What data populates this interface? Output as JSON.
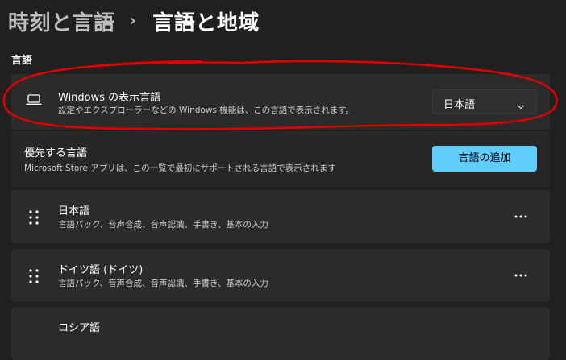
{
  "breadcrumb": {
    "parent": "時刻と言語",
    "separator": "›",
    "current": "言語と地域"
  },
  "section": {
    "title": "言語"
  },
  "display_language": {
    "title": "Windows の表示言語",
    "subtitle": "設定やエクスプローラーなどの Windows 機能は、この言語で表示されます。",
    "icon": "laptop-icon",
    "dropdown_value": "日本語"
  },
  "preferred_languages": {
    "title": "優先する言語",
    "subtitle": "Microsoft Store アプリは、この一覧で最初にサポートされる言語で表示されます",
    "add_button_label": "言語の追加"
  },
  "languages": [
    {
      "name": "日本語",
      "features": "言語パック、音声合成、音声認識、手書き、基本の入力"
    },
    {
      "name": "ドイツ語 (ドイツ)",
      "features": "言語パック、音声合成、音声認識、手書き、基本の入力"
    },
    {
      "name": "ロシア語",
      "features": ""
    }
  ],
  "colors": {
    "accent": "#60cdff",
    "background": "#202020",
    "card": "#2b2b2b",
    "annotation": "#e00000"
  }
}
